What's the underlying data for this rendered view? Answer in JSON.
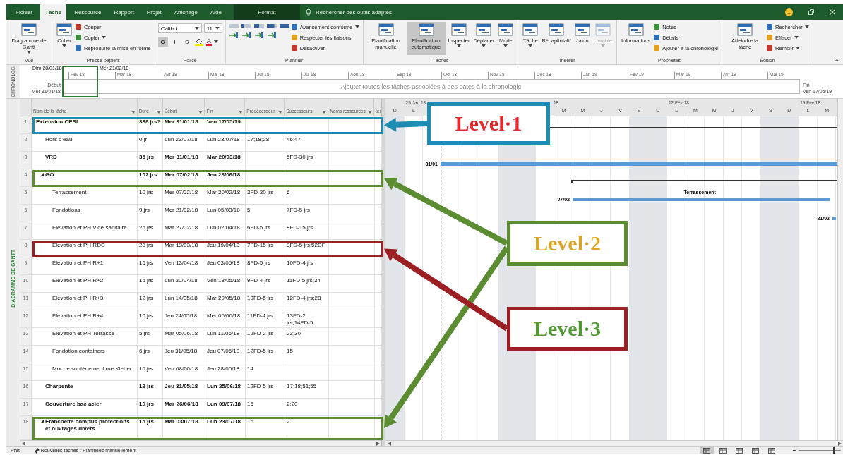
{
  "window": {
    "tabs": [
      {
        "label": "Fichier",
        "selected": false
      },
      {
        "label": "Tâche",
        "selected": true
      },
      {
        "label": "Ressource",
        "selected": false
      },
      {
        "label": "Rapport",
        "selected": false
      },
      {
        "label": "Projet",
        "selected": false
      },
      {
        "label": "Affichage",
        "selected": false
      },
      {
        "label": "Aide",
        "selected": false
      }
    ],
    "context_tab": "Format",
    "search": {
      "placeholder": "Rechercher des outils adaptés"
    }
  },
  "ribbon": {
    "groups": [
      {
        "label": "Vue",
        "items": [
          {
            "kind": "large",
            "label": "Diagramme de Gantt",
            "menu": true
          }
        ]
      },
      {
        "label": "Presse-papiers",
        "items": [
          {
            "kind": "large",
            "label": "Coller",
            "menu": true
          },
          {
            "kind": "small",
            "label": "Couper"
          },
          {
            "kind": "small",
            "label": "Copier",
            "menu": true
          },
          {
            "kind": "small",
            "label": "Reproduire la mise en forme"
          }
        ]
      },
      {
        "label": "Police",
        "items": [
          {
            "kind": "font",
            "font": "Calibri",
            "size": "11",
            "buttons": [
              {
                "label": "G",
                "selected": true
              },
              {
                "label": "I",
                "selected": false
              },
              {
                "label": "S",
                "selected": false
              }
            ],
            "font_color": "A"
          }
        ]
      },
      {
        "label": "Planifier",
        "items": [
          {
            "kind": "progress"
          },
          {
            "kind": "small",
            "label": "Avancement conforme",
            "menu": true
          },
          {
            "kind": "small",
            "label": "Respecter les liaisons"
          },
          {
            "kind": "small",
            "label": "Désactiver"
          }
        ]
      },
      {
        "label": "Tâches",
        "items": [
          {
            "kind": "large",
            "label": "Planification manuelle",
            "selected": false
          },
          {
            "kind": "large",
            "label": "Planification automatique",
            "selected": true
          },
          {
            "kind": "large",
            "label": "Inspecter",
            "menu": true,
            "selected": false
          },
          {
            "kind": "large",
            "label": "Déplacer",
            "menu": true,
            "selected": false
          },
          {
            "kind": "large",
            "label": "Mode",
            "menu": true,
            "selected": false
          }
        ]
      },
      {
        "label": "Insérer",
        "items": [
          {
            "kind": "large",
            "label": "Tâche",
            "menu": true,
            "disabled": false
          },
          {
            "kind": "large",
            "label": "Récapitulatif",
            "disabled": false
          },
          {
            "kind": "large",
            "label": "Jalon",
            "disabled": false
          },
          {
            "kind": "large",
            "label": "Livrable",
            "menu": true,
            "disabled": true
          }
        ]
      },
      {
        "label": "Propriétés",
        "items": [
          {
            "kind": "large",
            "label": "Informations"
          },
          {
            "kind": "small",
            "label": "Notes"
          },
          {
            "kind": "small",
            "label": "Détails"
          },
          {
            "kind": "small",
            "label": "Ajouter à la chronologie"
          }
        ]
      },
      {
        "label": "Édition",
        "items": [
          {
            "kind": "large",
            "label": "Atteindre la tâche"
          },
          {
            "kind": "small",
            "label": "Rechercher",
            "menu": true
          },
          {
            "kind": "small",
            "label": "Effacer",
            "menu": true
          },
          {
            "kind": "small",
            "label": "Remplir",
            "menu": true
          }
        ]
      }
    ]
  },
  "timeline": {
    "side_label": "CHRONOLOGI",
    "top_dates": [
      "Dim 28/01/18",
      "Mer 21/02/18"
    ],
    "months": [
      "Fév 18",
      "Mar 18",
      "Avr 18",
      "Mai 18",
      "Jui 18",
      "Jul 18",
      "Aoû 18",
      "Sep 18",
      "Oct 18",
      "Nov 18",
      "Déc 18",
      "Jan 19",
      "Fév 19",
      "Mar 19",
      "Avr 19",
      "Mai 19"
    ],
    "start_label": "Début",
    "start_date": "Mer 31/01/18",
    "end_label": "Fin",
    "end_date": "Ven 17/05/19",
    "placeholder": "Ajouter toutes les tâches associées à des dates à la chronologie"
  },
  "view_label": "DIAGRAMME DE GANTT",
  "table": {
    "columns": [
      "Nom de la tâche",
      "Duré",
      "Début",
      "Fin",
      "Prédécesseur",
      "Successeurs",
      "Noms ressources",
      "ter"
    ],
    "rows": [
      {
        "id": "1",
        "name": "Extension CESI",
        "duration": "338 jrs?",
        "start": "Mer 31/01/18",
        "finish": "Ven 17/05/19",
        "summary": true,
        "expanded": true,
        "highlight": {
          "color": "#1d8db3"
        },
        "children": [
          {
            "id": "2",
            "name": "Hors d'eau",
            "duration": "0 jr",
            "start": "Lun 23/07/18",
            "finish": "Lun 23/07/18",
            "predecessors": "17;18;28",
            "successors": "46;47",
            "summary": false,
            "expanded": false
          },
          {
            "id": "3",
            "name": "VRD",
            "duration": "35 jrs",
            "start": "Mer 31/01/18",
            "finish": "Mar 20/03/18",
            "successors": "5FD-30 jrs",
            "summary": true,
            "expanded": false
          },
          {
            "id": "4",
            "name": "GO",
            "duration": "102 jrs",
            "start": "Mer 07/02/18",
            "finish": "Jeu 28/06/18",
            "summary": true,
            "expanded": true,
            "highlight": {
              "color": "#5b8c32"
            },
            "children": [
              {
                "id": "5",
                "name": "Terrassement",
                "duration": "10 jrs",
                "start": "Mer 07/02/18",
                "finish": "Mar 20/02/18",
                "predecessors": "3FD-30 jrs",
                "successors": "6",
                "summary": false,
                "expanded": false
              },
              {
                "id": "6",
                "name": "Fondations",
                "duration": "9 jrs",
                "start": "Mer 21/02/18",
                "finish": "Lun 05/03/18",
                "predecessors": "5",
                "successors": "7FD-5 jrs",
                "summary": false,
                "expanded": false
              },
              {
                "id": "7",
                "name": "Elévation et PH Vide sanitaire",
                "duration": "25 jrs",
                "start": "Mar 27/02/18",
                "finish": "Lun 02/04/18",
                "predecessors": "6FD-5 jrs",
                "successors": "8FD-15 jrs",
                "summary": false,
                "expanded": false
              },
              {
                "id": "8",
                "name": "Elévation et PH RDC",
                "duration": "28 jrs",
                "start": "Mar 13/03/18",
                "finish": "Jeu 19/04/18",
                "predecessors": "7FD-15 jrs",
                "successors": "9FD-5 jrs;52DF",
                "summary": false,
                "expanded": false,
                "highlight": {
                  "color": "#9c1f24"
                }
              },
              {
                "id": "9",
                "name": "Elévation et PH R+1",
                "duration": "15 jrs",
                "start": "Ven 13/04/18",
                "finish": "Jeu 03/05/18",
                "predecessors": "8FD-5 jrs",
                "successors": "10FD-4 jrs",
                "summary": false,
                "expanded": false
              },
              {
                "id": "10",
                "name": "Elévation et PH R+2",
                "duration": "15 jrs",
                "start": "Lun 30/04/18",
                "finish": "Ven 18/05/18",
                "predecessors": "9FD-4 jrs",
                "successors": "11FD-5 jrs;34",
                "summary": false,
                "expanded": false
              },
              {
                "id": "11",
                "name": "Elévation et PH R+3",
                "duration": "12 jrs",
                "start": "Lun 14/05/18",
                "finish": "Mar 29/05/18",
                "predecessors": "10FD-5 jrs",
                "successors": "12FD-4 jrs;28",
                "summary": false,
                "expanded": false
              },
              {
                "id": "12",
                "name": "Elévation et PH R+4",
                "duration": "10 jrs",
                "start": "Jeu 24/05/18",
                "finish": "Mer 06/06/18",
                "predecessors": "11FD-4 jrs",
                "successors": "13FD-2 jrs;14FD-5",
                "summary": false,
                "expanded": false
              },
              {
                "id": "13",
                "name": "Elévation et PH Terrasse",
                "duration": "5 jrs",
                "start": "Mar 05/06/18",
                "finish": "Lun 11/06/18",
                "predecessors": "12FD-2 jrs",
                "successors": "23;30",
                "summary": false,
                "expanded": false
              },
              {
                "id": "14",
                "name": "Fondation containers",
                "duration": "6 jrs",
                "start": "Jeu 31/05/18",
                "finish": "Jeu 07/06/18",
                "predecessors": "12FD-5 jrs",
                "successors": "15",
                "summary": false,
                "expanded": false
              },
              {
                "id": "15",
                "name": "Mur de soutènement rue Kleber",
                "duration": "15 jrs",
                "start": "Ven 08/06/18",
                "finish": "Jeu 28/06/18",
                "predecessors": "14",
                "summary": false,
                "expanded": false
              }
            ]
          },
          {
            "id": "16",
            "name": "Charpente",
            "duration": "18 jrs",
            "start": "Jeu 31/05/18",
            "finish": "Lun 25/06/18",
            "predecessors": "12FD-5 jrs",
            "successors": "17;18;51;55",
            "summary": true,
            "expanded": false
          },
          {
            "id": "17",
            "name": "Couverture bac acier",
            "duration": "10 jrs",
            "start": "Mar 26/06/18",
            "finish": "Lun 09/07/18",
            "predecessors": "16",
            "successors": "2;20",
            "summary": true,
            "expanded": false
          },
          {
            "id": "18",
            "name": "Etanchéité compris protections et ouvrages divers",
            "duration": "15 jrs",
            "start": "Mar 03/07/18",
            "finish": "Lun 23/07/18",
            "predecessors": "16",
            "successors": "2",
            "summary": true,
            "expanded": true,
            "highlight": {
              "color": "#5b8c32"
            }
          }
        ]
      }
    ]
  },
  "gantt": {
    "weeks": [
      "29 Jan 18",
      "18",
      "12 Fév 18",
      "19 Fév 18"
    ],
    "days": [
      {
        "letter": "D",
        "weekend": true
      },
      {
        "letter": "L",
        "weekend": false
      },
      {
        "weekend": false
      },
      {
        "weekend": false
      },
      {
        "weekend": false
      },
      {
        "weekend": false
      },
      {
        "weekend": true
      },
      {
        "weekend": true
      },
      {
        "weekend": false
      },
      {
        "letter": "M",
        "weekend": false
      },
      {
        "letter": "M",
        "weekend": false
      },
      {
        "letter": "J",
        "weekend": false
      },
      {
        "letter": "V",
        "weekend": false
      },
      {
        "letter": "S",
        "weekend": true
      },
      {
        "letter": "D",
        "weekend": true
      },
      {
        "letter": "L",
        "weekend": false
      },
      {
        "letter": "M",
        "weekend": false
      },
      {
        "letter": "M",
        "weekend": false
      },
      {
        "letter": "J",
        "weekend": false
      },
      {
        "letter": "V",
        "weekend": false
      },
      {
        "letter": "S",
        "weekend": true
      },
      {
        "letter": "D",
        "weekend": true
      },
      {
        "letter": "L",
        "weekend": false
      },
      {
        "letter": "M",
        "weekend": false
      }
    ],
    "bars": [
      {
        "kind": "summary"
      },
      {
        "kind": "task",
        "label_left": "31/01"
      },
      {
        "kind": "summary"
      },
      {
        "kind": "task",
        "label_left": "07/02",
        "label_top": "Terrassement"
      },
      {
        "kind": "task",
        "label_left": "21/02"
      }
    ]
  },
  "annotations": [
    {
      "color": "#1d8db3",
      "label": {
        "text": "Level·1",
        "color": "#e5262a"
      }
    },
    {
      "color": "#5b8c32",
      "label": {
        "text": "Level·2",
        "color": "#d9a526"
      }
    },
    {
      "color": "#9c1f24",
      "label": {
        "text": "Level·3",
        "color": "#4f9a31"
      }
    }
  ],
  "status_bar": {
    "ready": "Prêt",
    "new_tasks": "Nouvelles tâches : Planifiées manuellement",
    "views": [
      {
        "selected": true
      },
      {
        "selected": false
      },
      {
        "selected": false
      },
      {
        "selected": false
      },
      {
        "selected": false
      }
    ],
    "zoom": {
      "level": 0.82
    }
  }
}
